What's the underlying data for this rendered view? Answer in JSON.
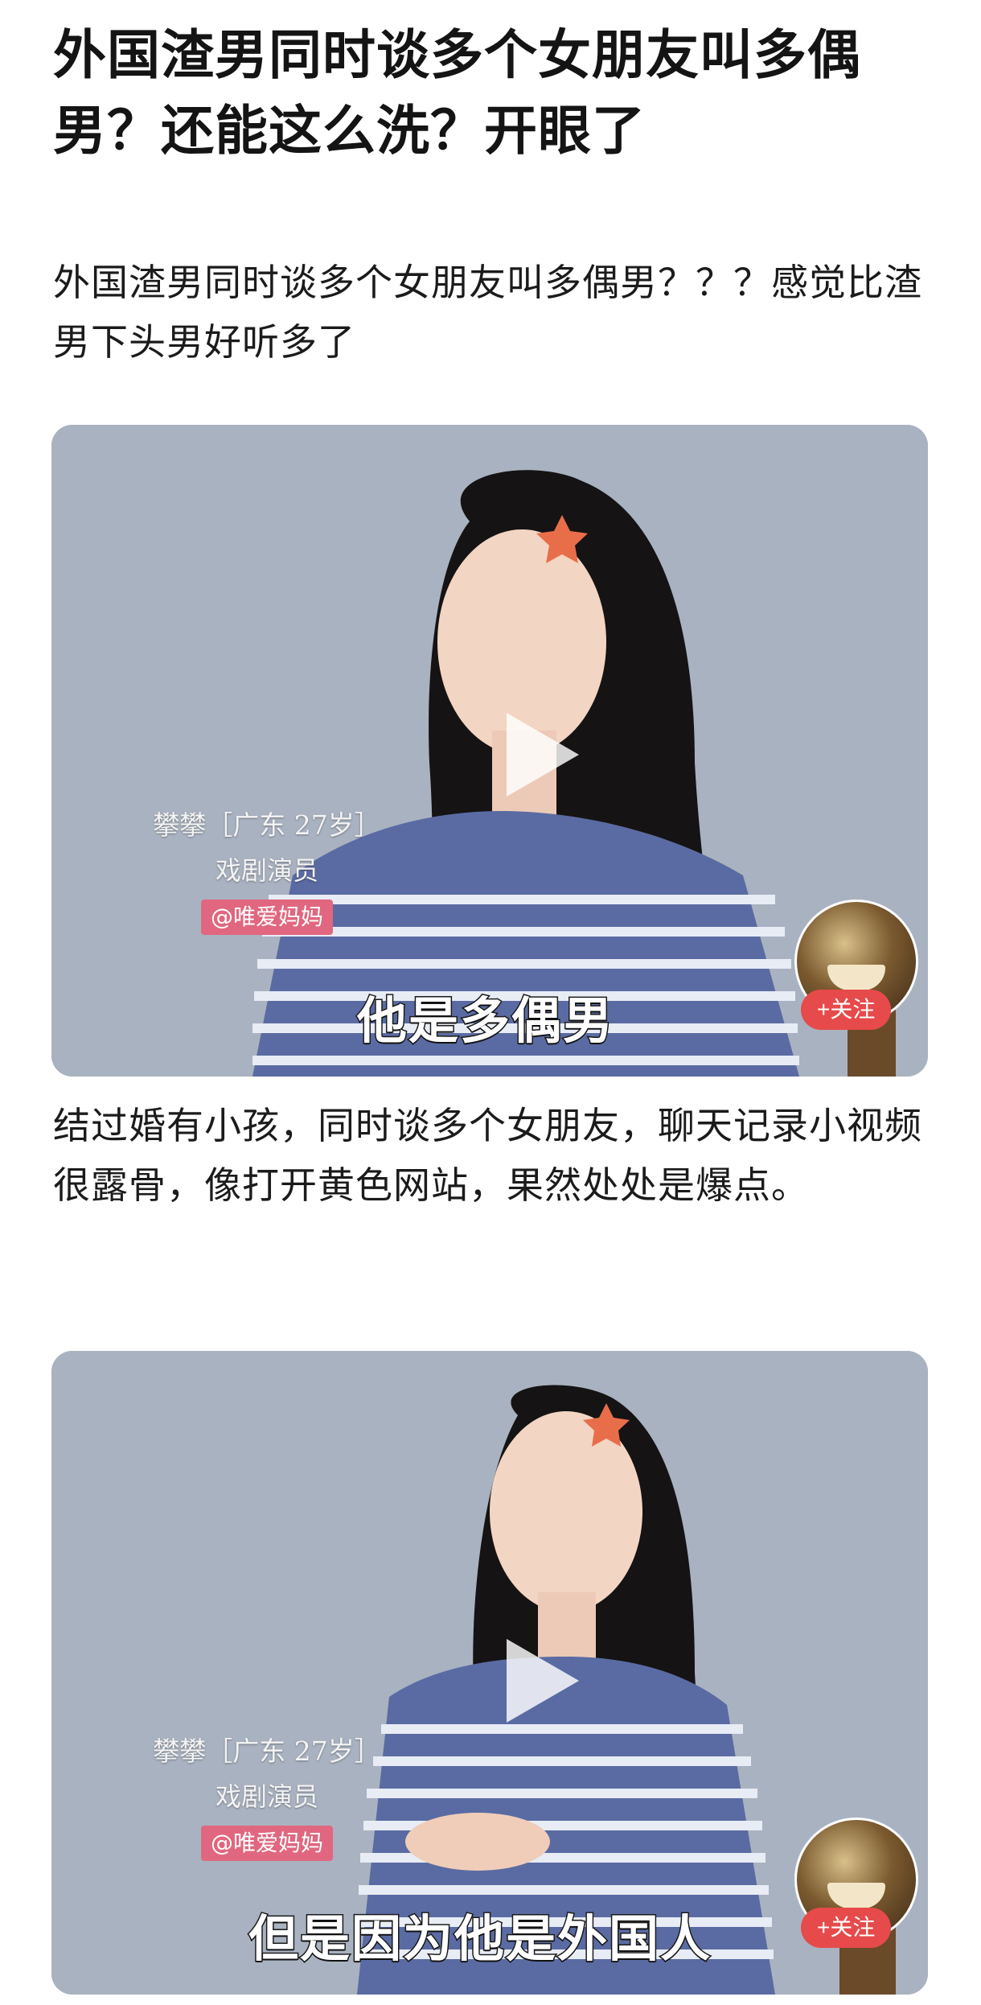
{
  "article": {
    "title": "外国渣男同时谈多个女朋友叫多偶男？还能这么洗？开眼了",
    "intro": "外国渣男同时谈多个女朋友叫多偶男？？？感觉比渣男下头男好听多了",
    "body": "结过婚有小孩，同时谈多个女朋友，聊天记录小视频很露骨，像打开黄色网站，果然处处是爆点。"
  },
  "videos": [
    {
      "info_name": "攀攀［广东 27岁］",
      "info_role": "戏剧演员",
      "channel": "@唯爱妈妈",
      "subtitle": "他是多偶男",
      "follow_label": "+关注",
      "play_icon": "play-icon"
    },
    {
      "info_name": "攀攀［广东 27岁］",
      "info_role": "戏剧演员",
      "channel": "@唯爱妈妈",
      "subtitle": "但是因为他是外国人",
      "follow_label": "+关注",
      "play_icon": "play-icon"
    }
  ],
  "colors": {
    "background": "#ffffff",
    "video_backdrop": "#a8b1bf",
    "follow_button": "#e64a4a",
    "channel_tag": "#e0677f"
  }
}
